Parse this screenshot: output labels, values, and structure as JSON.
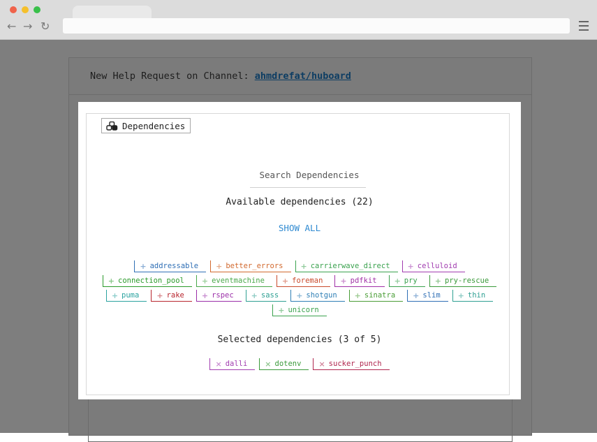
{
  "browser": {},
  "header": {
    "prefix": "New Help Request on Channel: ",
    "channel": "ahmdrefat/huboard"
  },
  "modal": {
    "legend": "Dependencies",
    "search_placeholder": "Search Dependencies",
    "available_title": "Available dependencies (22)",
    "show_all": "SHOW ALL",
    "selected_title": "Selected dependencies (3 of 5)"
  },
  "available": [
    {
      "name": "addressable",
      "color": "#2f6fb5"
    },
    {
      "name": "better_errors",
      "color": "#d2692e"
    },
    {
      "name": "carrierwave_direct",
      "color": "#3aa24e"
    },
    {
      "name": "celluloid",
      "color": "#a13cb0"
    },
    {
      "name": "connection_pool",
      "color": "#2a9a2a"
    },
    {
      "name": "eventmachine",
      "color": "#4aa84a"
    },
    {
      "name": "foreman",
      "color": "#c94b2d"
    },
    {
      "name": "pdfkit",
      "color": "#a030a6"
    },
    {
      "name": "pry",
      "color": "#3aa24e"
    },
    {
      "name": "pry-rescue",
      "color": "#3a9a3a"
    },
    {
      "name": "puma",
      "color": "#2ba3a0"
    },
    {
      "name": "rake",
      "color": "#b8262e"
    },
    {
      "name": "rspec",
      "color": "#9b2fa8"
    },
    {
      "name": "sass",
      "color": "#2fa093"
    },
    {
      "name": "shotgun",
      "color": "#2f7fb5"
    },
    {
      "name": "sinatra",
      "color": "#4a9d36"
    },
    {
      "name": "slim",
      "color": "#2f6fb5"
    },
    {
      "name": "thin",
      "color": "#2fa093"
    },
    {
      "name": "unicorn",
      "color": "#3aa24e"
    }
  ],
  "selected": [
    {
      "name": "dalli",
      "color": "#a13cb0"
    },
    {
      "name": "dotenv",
      "color": "#3a9a3a"
    },
    {
      "name": "sucker_punch",
      "color": "#b0264e"
    }
  ],
  "icons": {
    "available_mark": "+",
    "selected_mark": "×",
    "legend_icon": "cubes-icon"
  }
}
